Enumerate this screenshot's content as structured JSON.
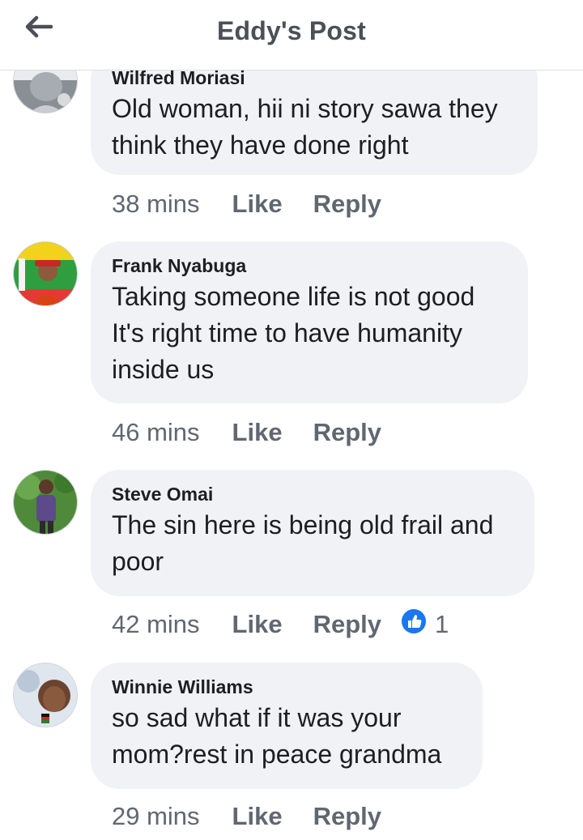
{
  "header": {
    "title": "Eddy's Post",
    "back_icon": "arrow-left-icon"
  },
  "colors": {
    "bubble": "#f0f2f5",
    "meta_text": "#606770",
    "like_blue": "#1877f2"
  },
  "comments": [
    {
      "author": "Wilfred Moriasi",
      "lines": [
        "Old woman, hii ni story sawa they",
        "think they have done right"
      ],
      "time": "38 mins",
      "like": "Like",
      "reply": "Reply"
    },
    {
      "author": "Frank Nyabuga",
      "lines": [
        "Taking someone  life is not good",
        "It's right time to have humanity",
        "inside us"
      ],
      "time": "46 mins",
      "like": "Like",
      "reply": "Reply"
    },
    {
      "author": "Steve Omai",
      "lines": [
        "The sin here is being old frail and",
        "poor"
      ],
      "time": "42 mins",
      "like": "Like",
      "reply": "Reply",
      "reactions": {
        "icon": "thumbs-up-icon",
        "count": "1"
      }
    },
    {
      "author": "Winnie Williams",
      "lines": [
        "so sad what if it was your",
        "mom?rest in peace grandma"
      ],
      "time": "29 mins",
      "like": "Like",
      "reply": "Reply"
    }
  ]
}
